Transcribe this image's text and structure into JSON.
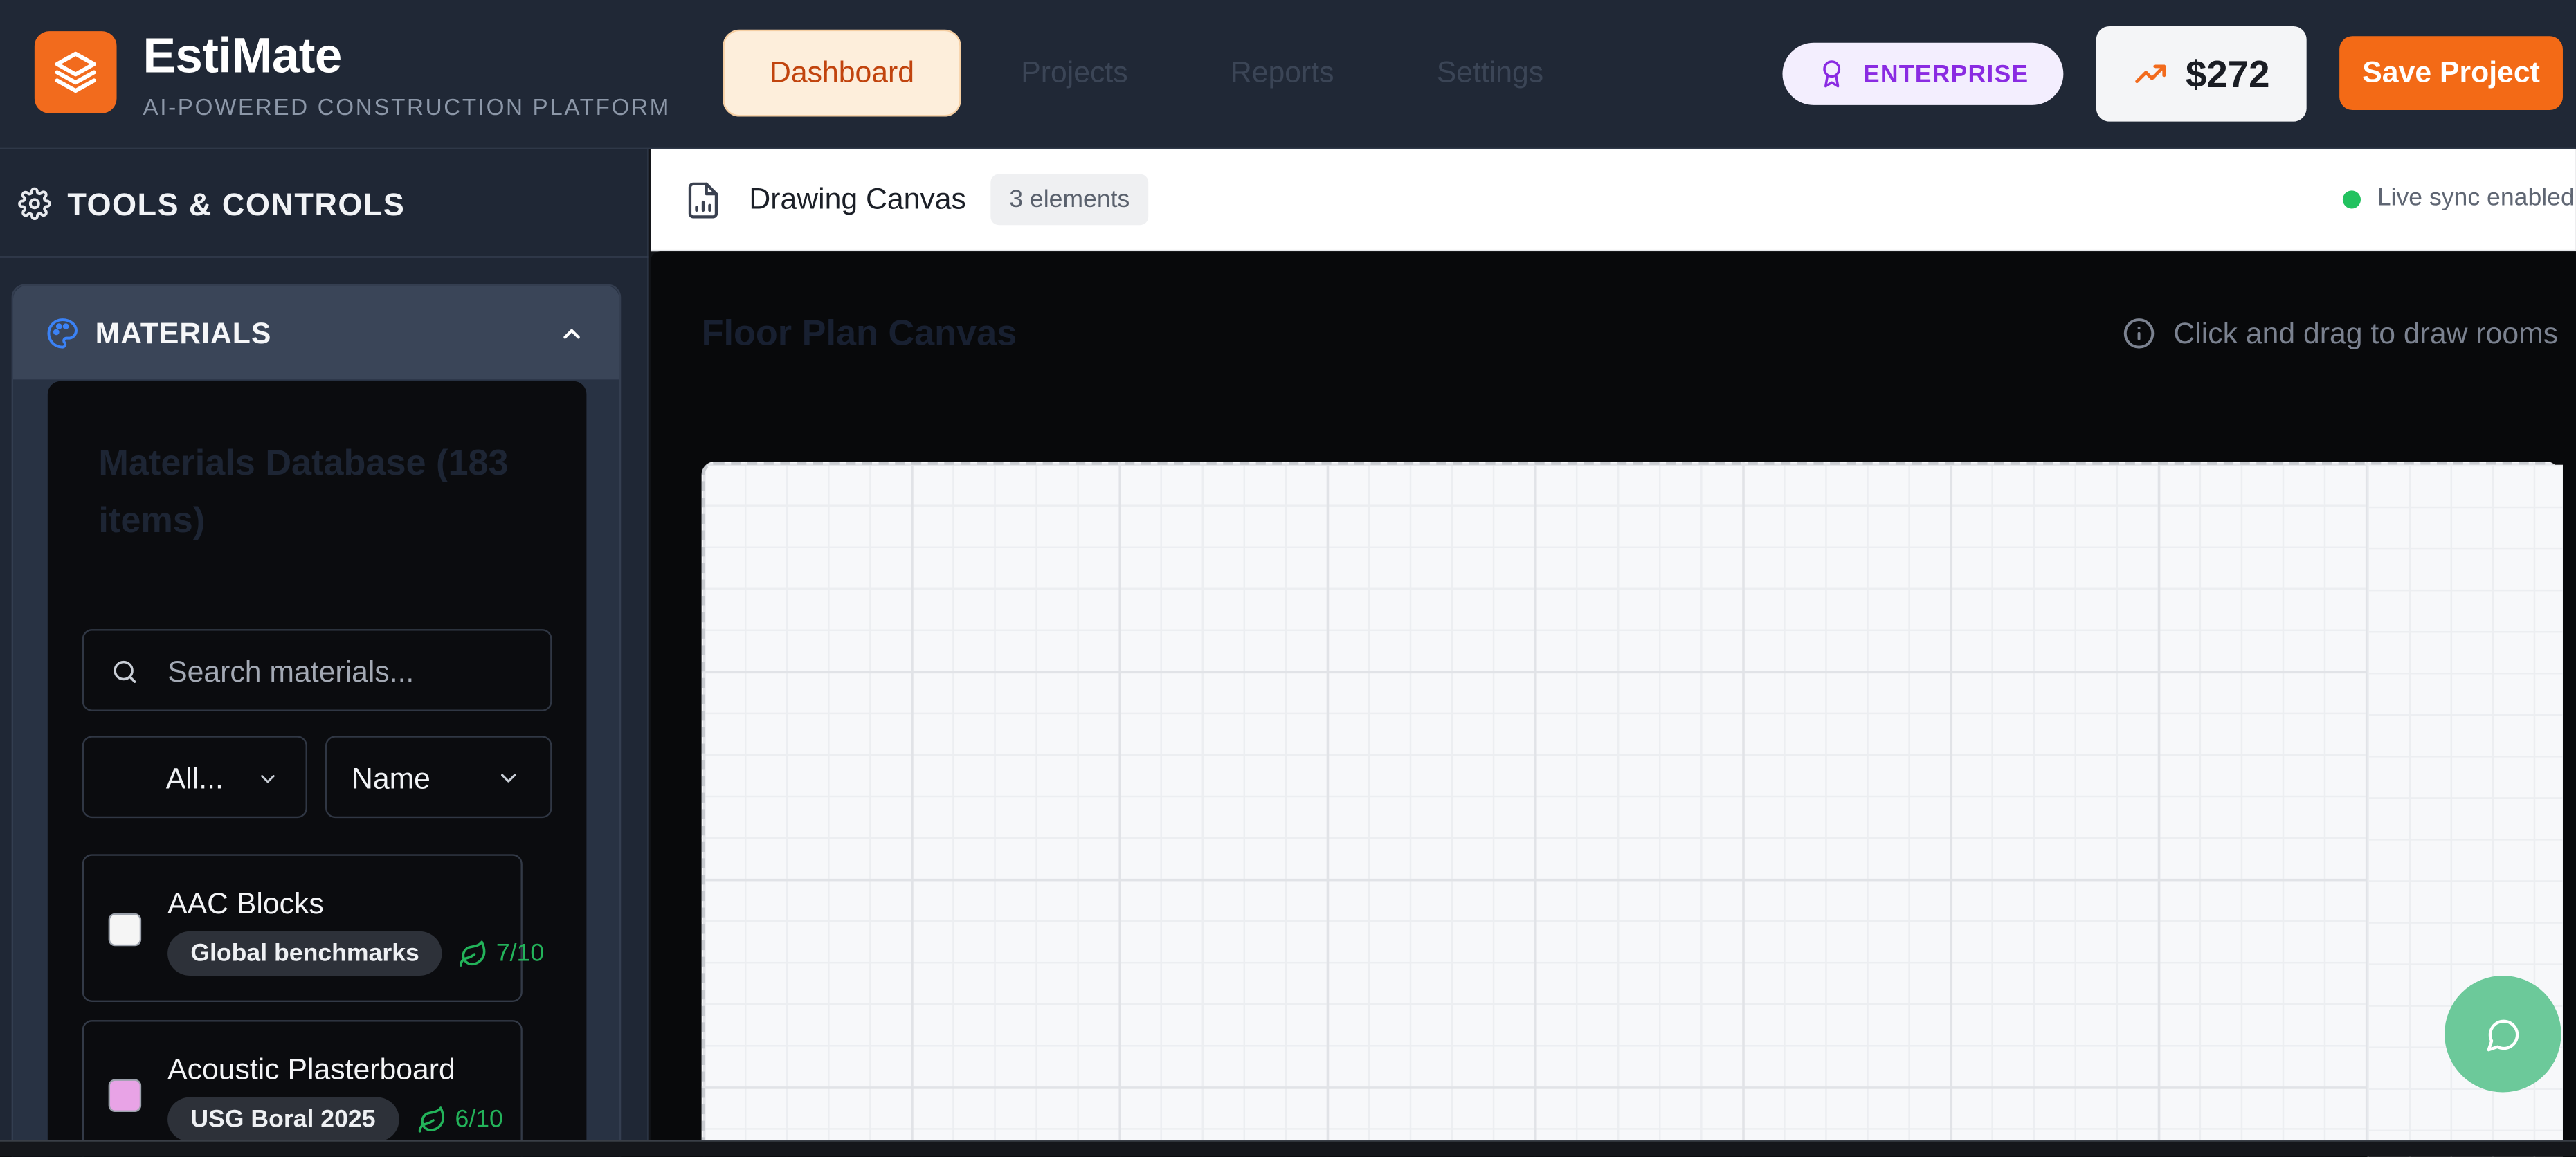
{
  "app": {
    "name": "EstiMate",
    "tagline": "AI-POWERED CONSTRUCTION PLATFORM",
    "logo_icon": "layers-icon"
  },
  "nav": {
    "tabs": [
      {
        "label": "Dashboard",
        "active": true
      },
      {
        "label": "Projects",
        "active": false
      },
      {
        "label": "Reports",
        "active": false
      },
      {
        "label": "Settings",
        "active": false
      }
    ]
  },
  "header": {
    "plan_badge": "ENTERPRISE",
    "cost": "$272",
    "save_label": "Save Project"
  },
  "sidebar": {
    "title": "TOOLS & CONTROLS",
    "materials": {
      "title": "MATERIALS",
      "db_title": "Materials Database (183 items)",
      "search_placeholder": "Search materials...",
      "filter_value": "All...",
      "sort_value": "Name",
      "items": [
        {
          "name": "AAC Blocks",
          "source": "Global benchmarks",
          "eco": "7/10",
          "color": "#f5f5f5"
        },
        {
          "name": "Acoustic Plasterboard",
          "source": "USG Boral 2025",
          "eco": "6/10",
          "color": "#e8a3e6"
        }
      ]
    }
  },
  "canvas": {
    "header_title": "Drawing Canvas",
    "element_count": "3 elements",
    "sync_status": "Live sync enabled",
    "panel_title": "Floor Plan Canvas",
    "hint": "Click and drag to draw rooms"
  },
  "colors": {
    "accent": "#f36a16",
    "header_bg": "#202836",
    "success": "#22c25f",
    "enterprise": "#8a2be2"
  }
}
